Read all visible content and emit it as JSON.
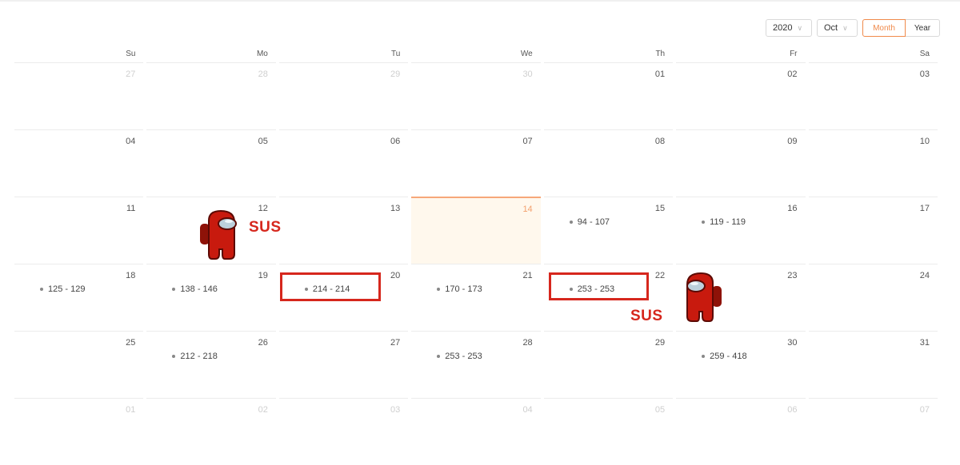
{
  "toolbar": {
    "year_value": "2020",
    "month_value": "Oct",
    "mode_month_label": "Month",
    "mode_year_label": "Year"
  },
  "colors": {
    "accent": "#f08a4b",
    "today_bg": "#fff8ed",
    "annotation_red": "#d6271d"
  },
  "weekdays": [
    "Su",
    "Mo",
    "Tu",
    "We",
    "Th",
    "Fr",
    "Sa"
  ],
  "weeks": [
    [
      {
        "d": "27",
        "o": true
      },
      {
        "d": "28",
        "o": true
      },
      {
        "d": "29",
        "o": true
      },
      {
        "d": "30",
        "o": true
      },
      {
        "d": "01"
      },
      {
        "d": "02"
      },
      {
        "d": "03"
      }
    ],
    [
      {
        "d": "04"
      },
      {
        "d": "05"
      },
      {
        "d": "06"
      },
      {
        "d": "07"
      },
      {
        "d": "08"
      },
      {
        "d": "09"
      },
      {
        "d": "10"
      }
    ],
    [
      {
        "d": "11"
      },
      {
        "d": "12"
      },
      {
        "d": "13"
      },
      {
        "d": "14",
        "today": true
      },
      {
        "d": "15",
        "ev": "94 - 107"
      },
      {
        "d": "16",
        "ev": "119 - 119"
      },
      {
        "d": "17"
      }
    ],
    [
      {
        "d": "18",
        "ev": "125 - 129"
      },
      {
        "d": "19",
        "ev": "138 - 146"
      },
      {
        "d": "20",
        "ev": "214 - 214"
      },
      {
        "d": "21",
        "ev": "170 - 173"
      },
      {
        "d": "22",
        "ev": "253 - 253"
      },
      {
        "d": "23"
      },
      {
        "d": "24"
      }
    ],
    [
      {
        "d": "25"
      },
      {
        "d": "26",
        "ev": "212 - 218"
      },
      {
        "d": "27"
      },
      {
        "d": "28",
        "ev": "253 - 253"
      },
      {
        "d": "29"
      },
      {
        "d": "30",
        "ev": "259 - 418"
      },
      {
        "d": "31"
      }
    ],
    [
      {
        "d": "01",
        "o": true
      },
      {
        "d": "02",
        "o": true
      },
      {
        "d": "03",
        "o": true
      },
      {
        "d": "04",
        "o": true
      },
      {
        "d": "05",
        "o": true
      },
      {
        "d": "06",
        "o": true
      },
      {
        "d": "07",
        "o": true
      }
    ]
  ],
  "annotations": {
    "sus_1": "SUS",
    "sus_2": "SUS"
  }
}
